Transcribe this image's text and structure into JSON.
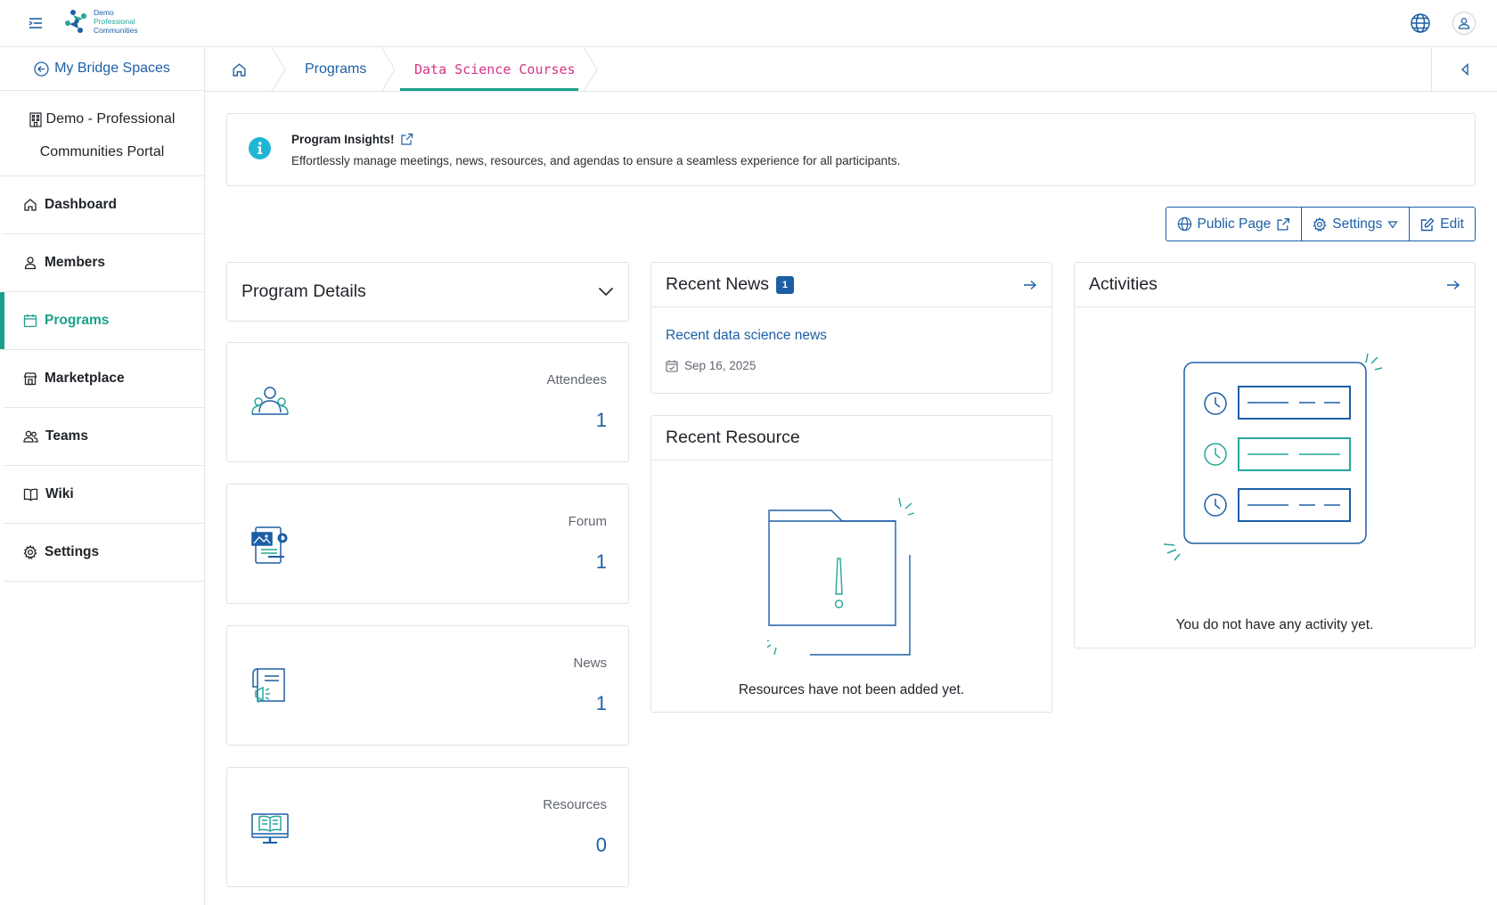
{
  "app": {
    "logo_lines": [
      "Demo",
      "Professional",
      "Communities"
    ]
  },
  "sidebar": {
    "back_label": "My Bridge Spaces",
    "org_name_line1": "Demo - Professional",
    "org_name_line2": "Communities Portal",
    "items": [
      {
        "label": "Dashboard",
        "icon": "home-icon"
      },
      {
        "label": "Members",
        "icon": "user-icon"
      },
      {
        "label": "Programs",
        "icon": "calendar-icon",
        "active": true
      },
      {
        "label": "Marketplace",
        "icon": "store-icon"
      },
      {
        "label": "Teams",
        "icon": "users-icon"
      },
      {
        "label": "Wiki",
        "icon": "book-icon"
      },
      {
        "label": "Settings",
        "icon": "gear-icon"
      }
    ]
  },
  "breadcrumb": {
    "programs": "Programs",
    "current": "Data Science Courses"
  },
  "insight": {
    "title": "Program Insights!",
    "text": "Effortlessly manage meetings, news, resources, and agendas to ensure a seamless experience for all participants."
  },
  "actions": {
    "public_page": "Public Page",
    "settings": "Settings",
    "edit": "Edit"
  },
  "program_details": {
    "title": "Program Details",
    "stats": [
      {
        "label": "Attendees",
        "value": "1",
        "icon": "attendees-icon"
      },
      {
        "label": "Forum",
        "value": "1",
        "icon": "forum-icon"
      },
      {
        "label": "News",
        "value": "1",
        "icon": "news-icon"
      },
      {
        "label": "Resources",
        "value": "0",
        "icon": "resources-icon"
      }
    ]
  },
  "recent_news": {
    "title": "Recent News",
    "count": "1",
    "item_title": "Recent data science news",
    "item_date": "Sep 16, 2025"
  },
  "recent_resource": {
    "title": "Recent Resource",
    "empty_text": "Resources have not been added yet."
  },
  "activities": {
    "title": "Activities",
    "empty_text": "You do not have any activity yet."
  },
  "colors": {
    "primary": "#1d5fa5",
    "accent": "#1aa088",
    "current_crumb": "#d63384",
    "info": "#1fb6d6"
  }
}
